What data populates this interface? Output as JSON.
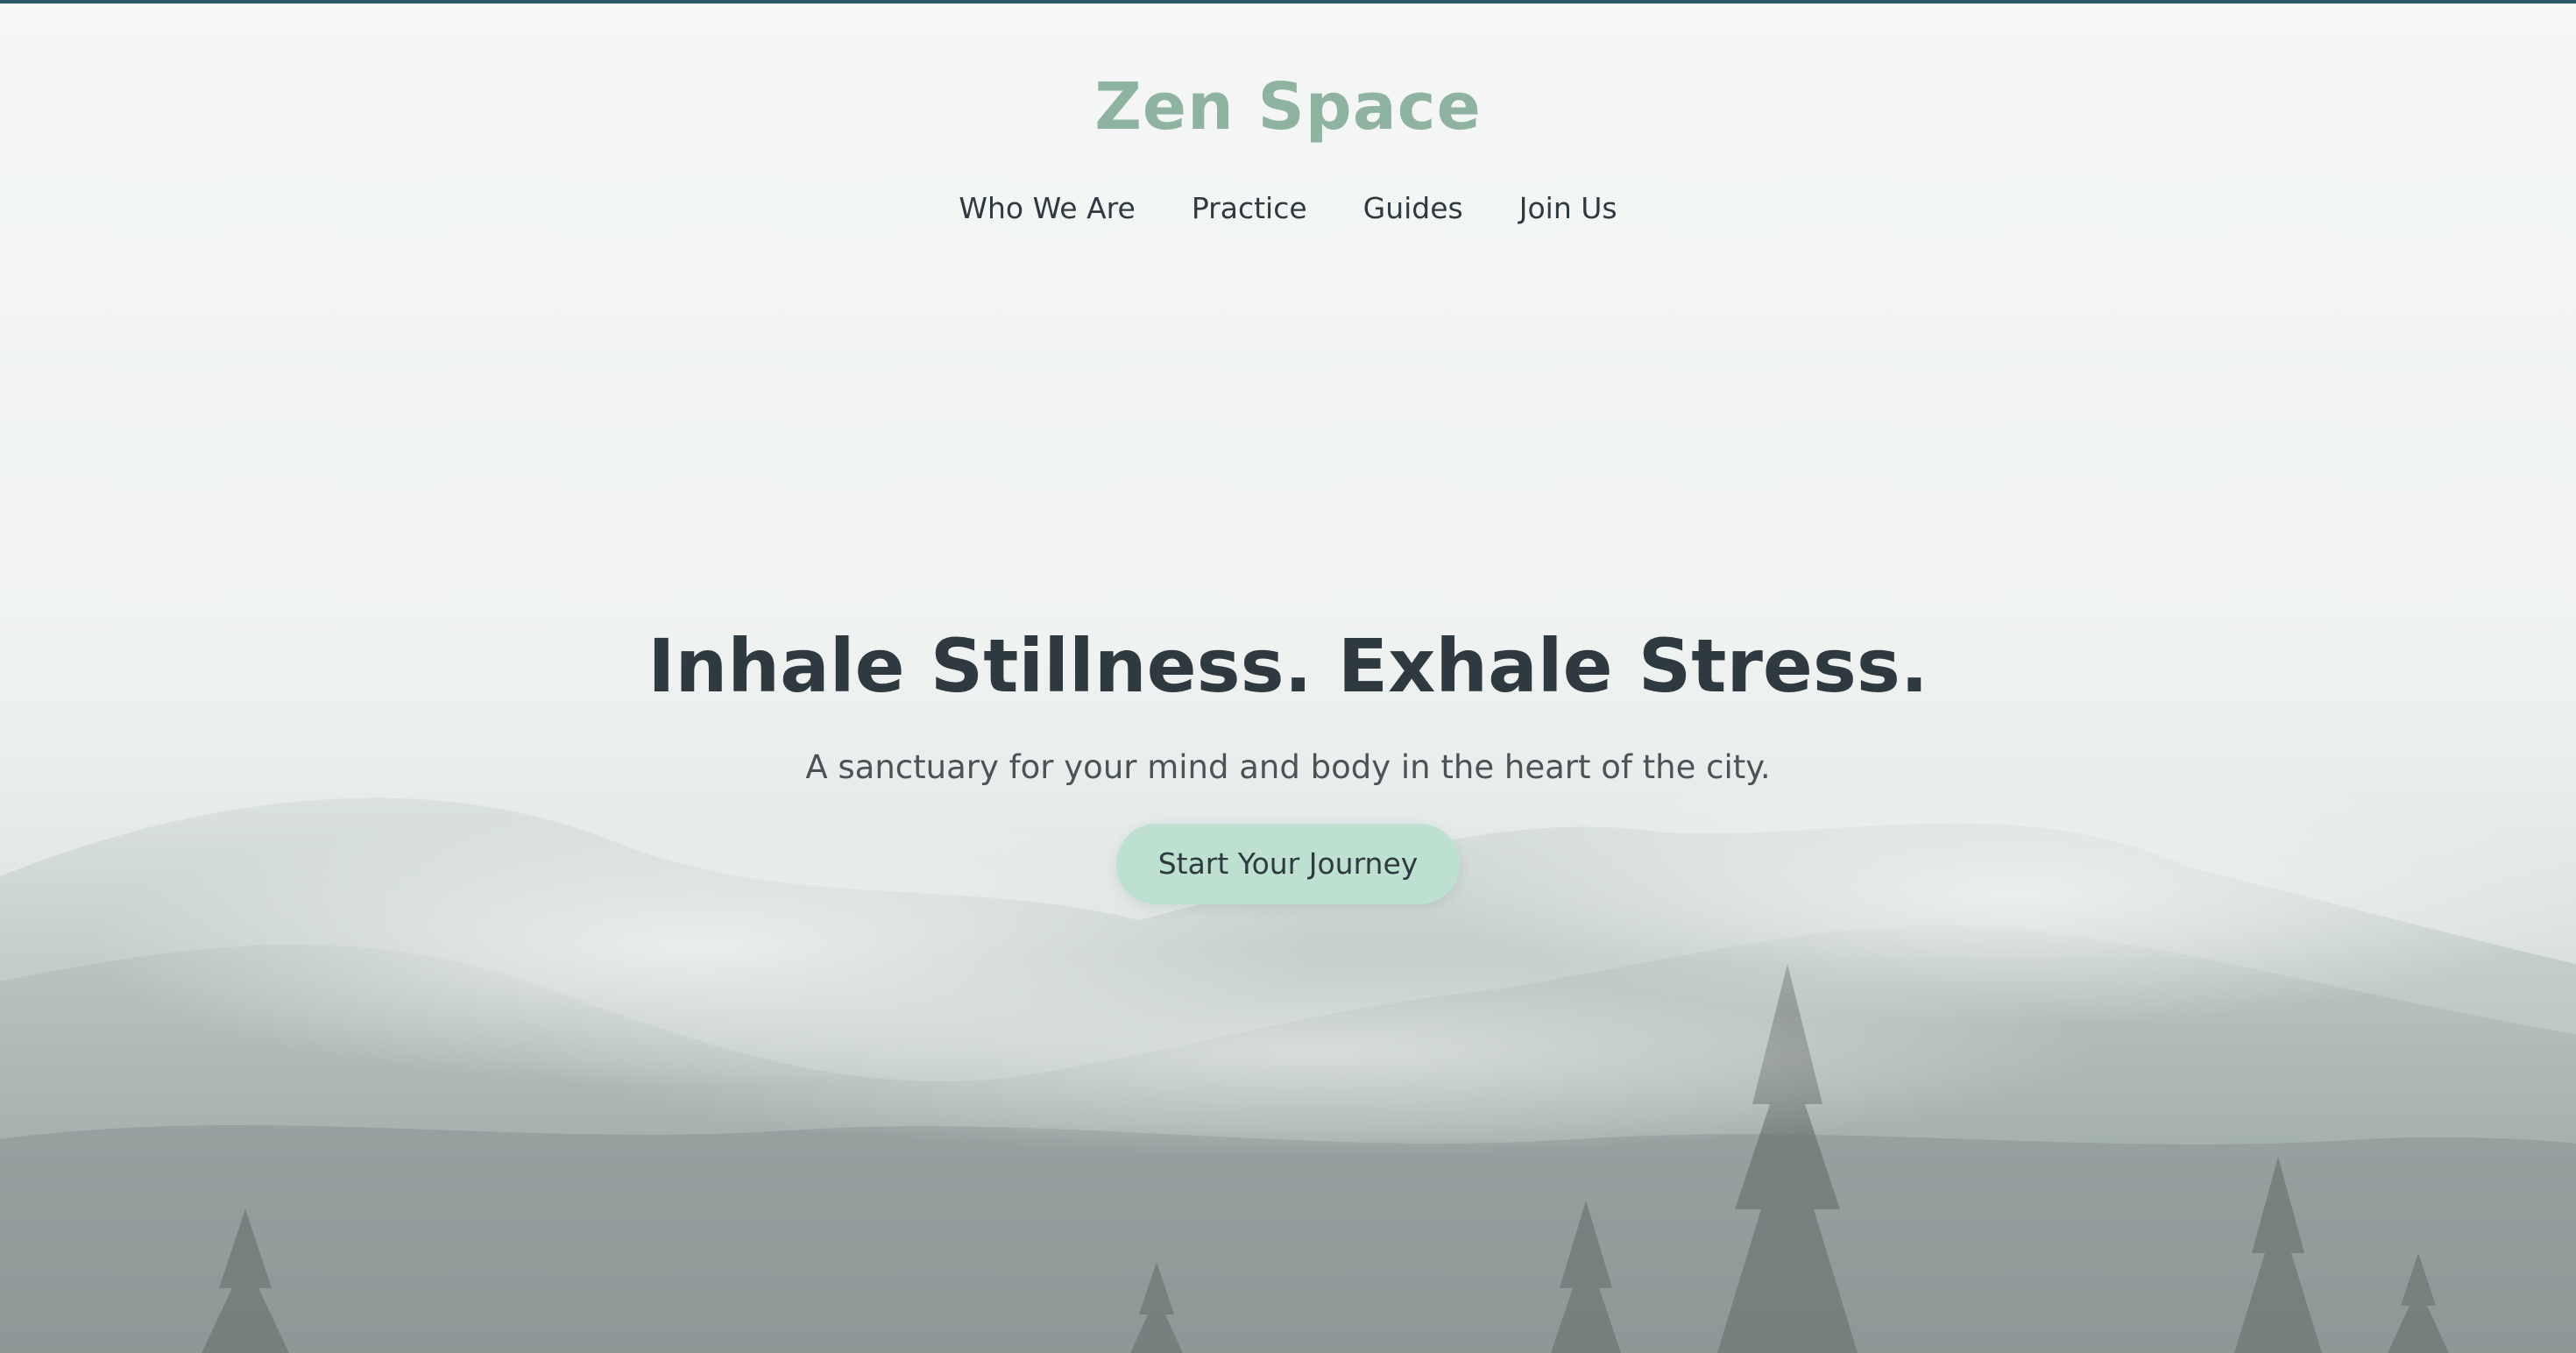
{
  "brand": {
    "name": "Zen Space",
    "color": "#8fb3a1"
  },
  "nav": {
    "items": [
      "Who We Are",
      "Practice",
      "Guides",
      "Join Us"
    ]
  },
  "hero": {
    "headline": "Inhale Stillness. Exhale Stress.",
    "subheadline": "A sanctuary for your mind and body in the heart of the city.",
    "cta_label": "Start Your Journey",
    "cta_color": "#bde0d1"
  },
  "colors": {
    "top_rule": "#2d5a66",
    "text_dark": "#2f3a40",
    "background": "#f5f7f6"
  },
  "background_image": "misty-forest-hills"
}
